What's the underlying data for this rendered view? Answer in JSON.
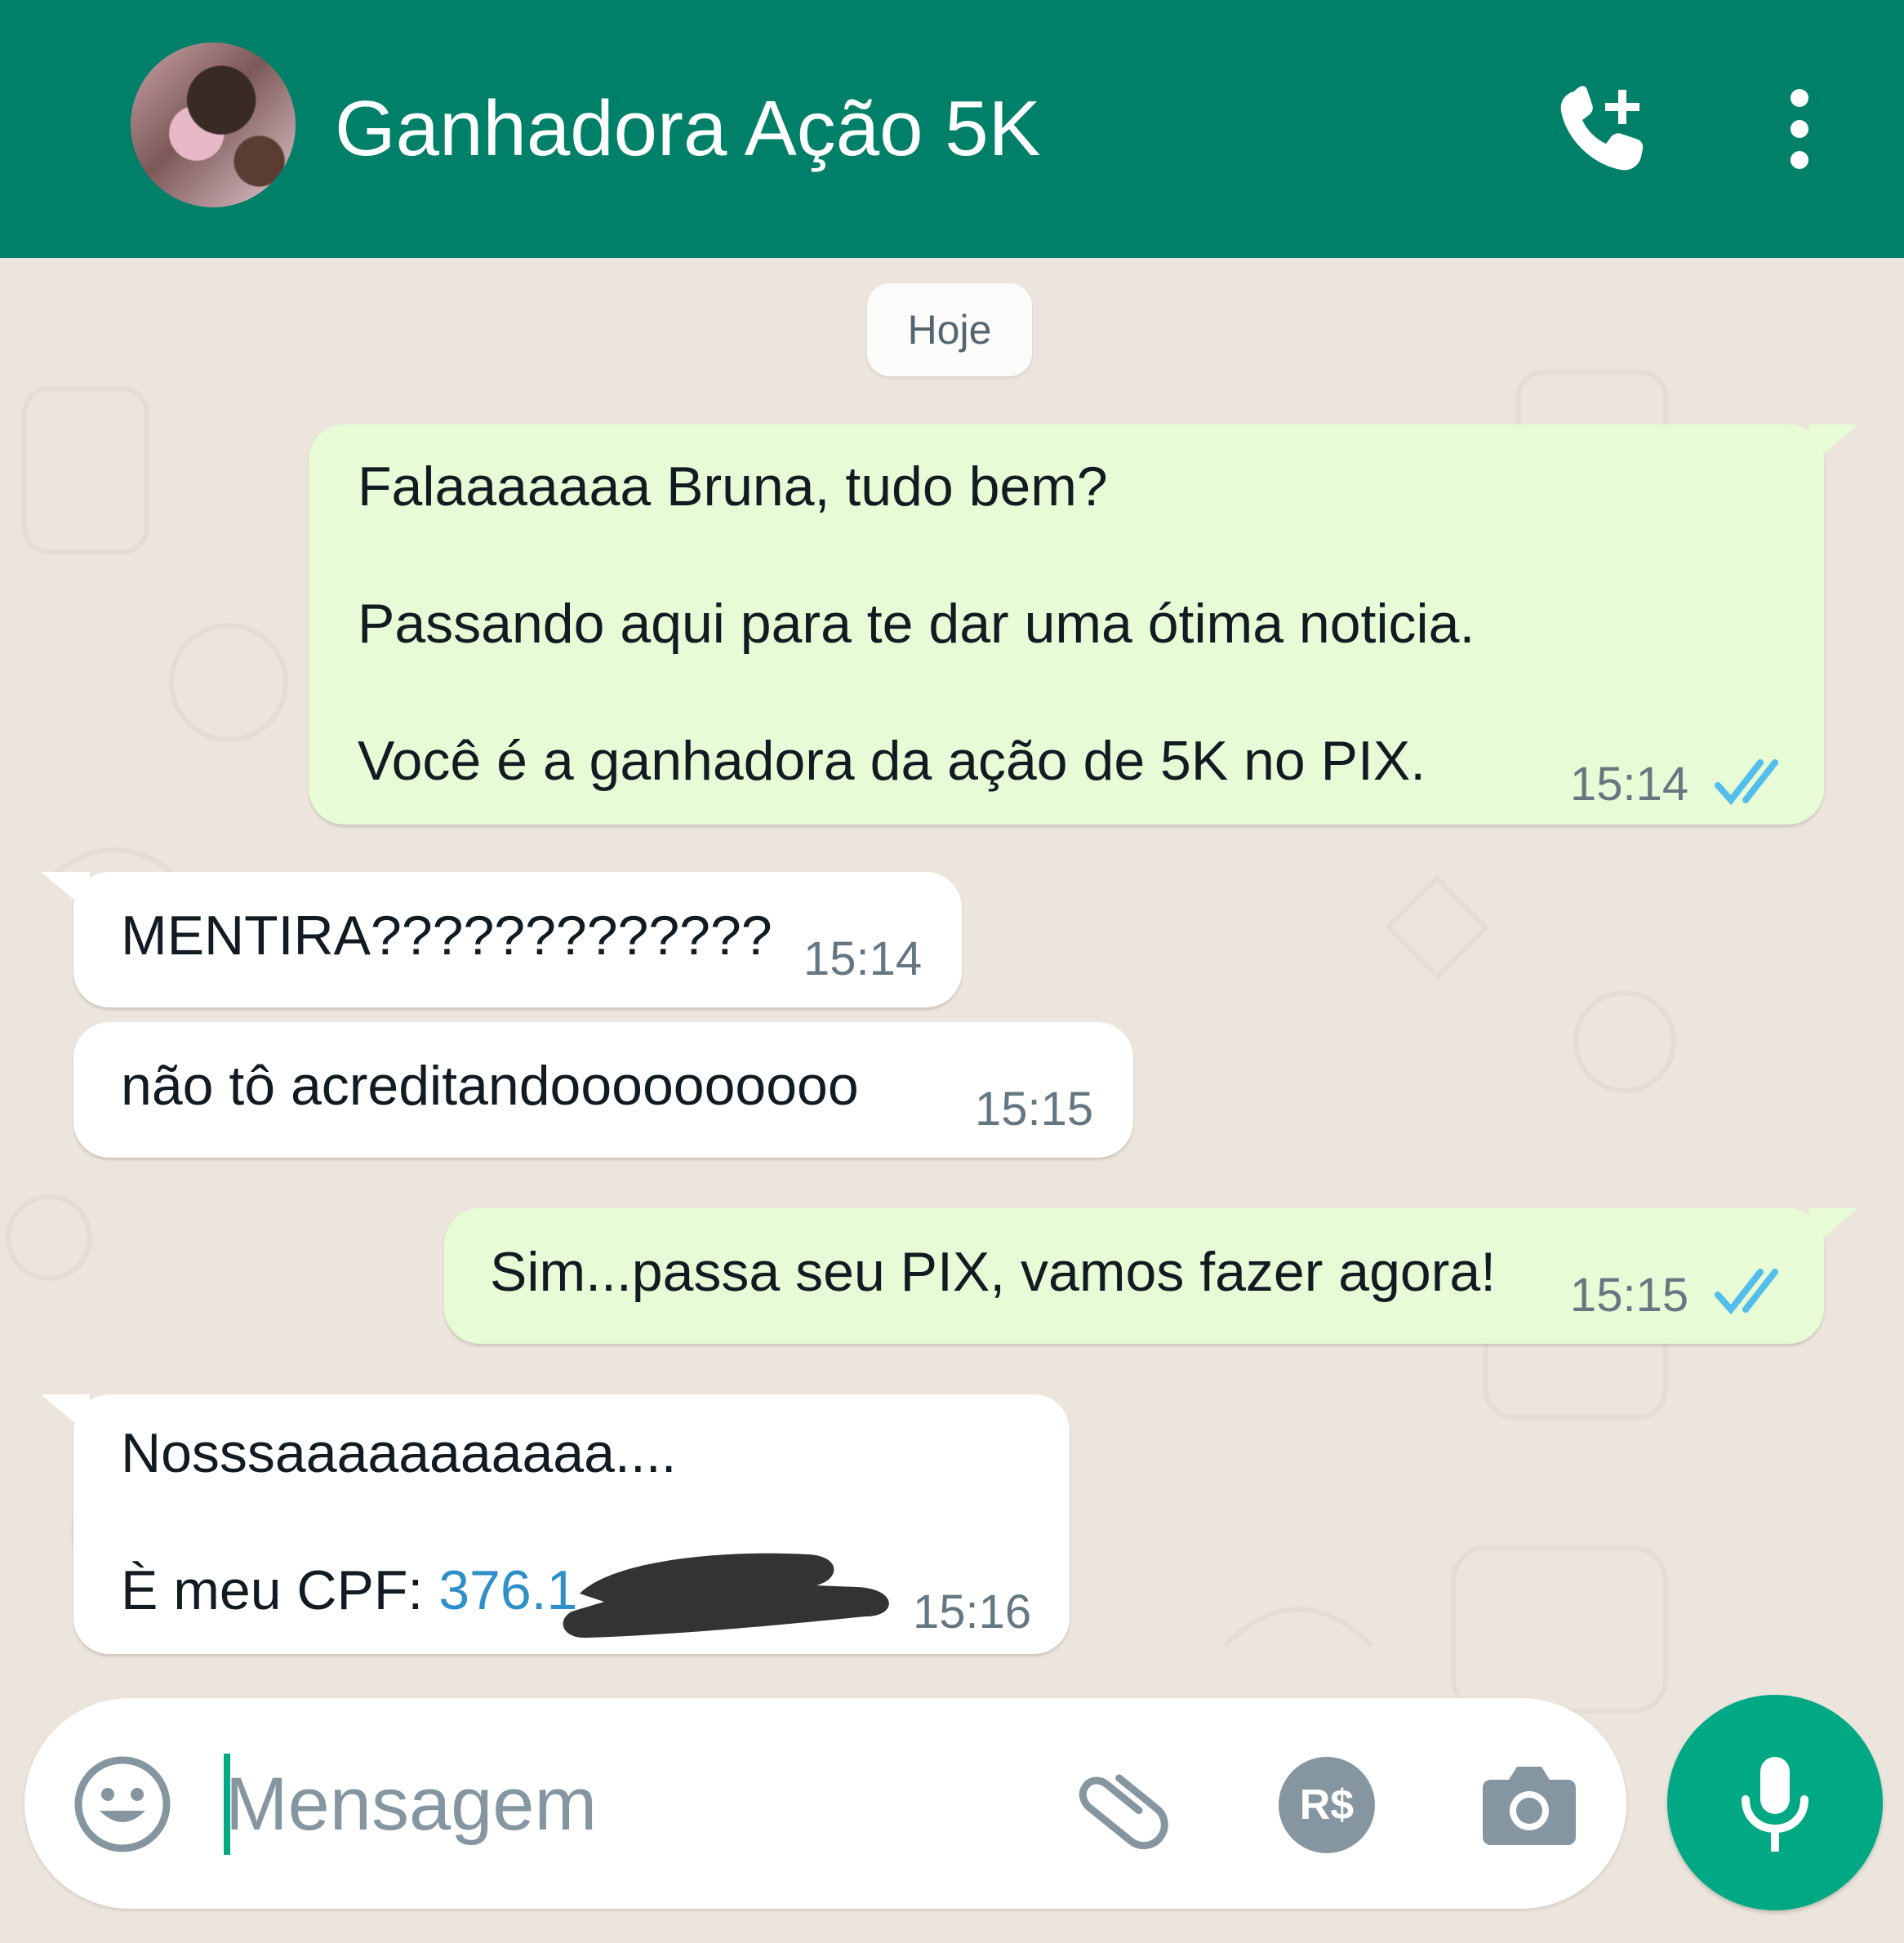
{
  "header": {
    "title": "Ganhadora Ação 5K",
    "avatar_icon": "profile-photo",
    "call_icon": "add-call-icon",
    "menu_icon": "more-vertical-icon",
    "color": "#008069"
  },
  "chat": {
    "day_label": "Hoje",
    "messages": [
      {
        "direction": "outgoing",
        "lines": [
          "Falaaaaaaa Bruna, tudo bem?",
          "Passando aqui para te dar uma ótima noticia.",
          "Você é a ganhadora da ação de 5K  no PIX."
        ],
        "time": "15:14",
        "status": "read"
      },
      {
        "direction": "incoming",
        "lines": [
          "MENTIRA?????????????"
        ],
        "time": "15:14"
      },
      {
        "direction": "incoming",
        "lines": [
          "não tô acreditandoooooooooo"
        ],
        "time": "15:15"
      },
      {
        "direction": "outgoing",
        "lines": [
          "Sim...passa seu PIX, vamos fazer agora!"
        ],
        "time": "15:15",
        "status": "read"
      },
      {
        "direction": "incoming",
        "lines": [
          "Nosssaaaaaaaaaaa....",
          "È meu CPF: "
        ],
        "cpf_visible": "376.1",
        "time": "15:16",
        "redacted": true
      }
    ],
    "colors": {
      "outgoing_bubble": "#e7fcd6",
      "incoming_bubble": "#ffffff",
      "read_ticks": "#53bdeb",
      "link": "#2f8fc8"
    }
  },
  "composer": {
    "placeholder": "Mensagem",
    "emoji_icon": "emoji-icon",
    "attach_icon": "paperclip-icon",
    "payment_icon": "payment-rs-icon",
    "payment_label": "R$",
    "camera_icon": "camera-icon",
    "mic_icon": "microphone-icon",
    "accent": "#00a884"
  }
}
